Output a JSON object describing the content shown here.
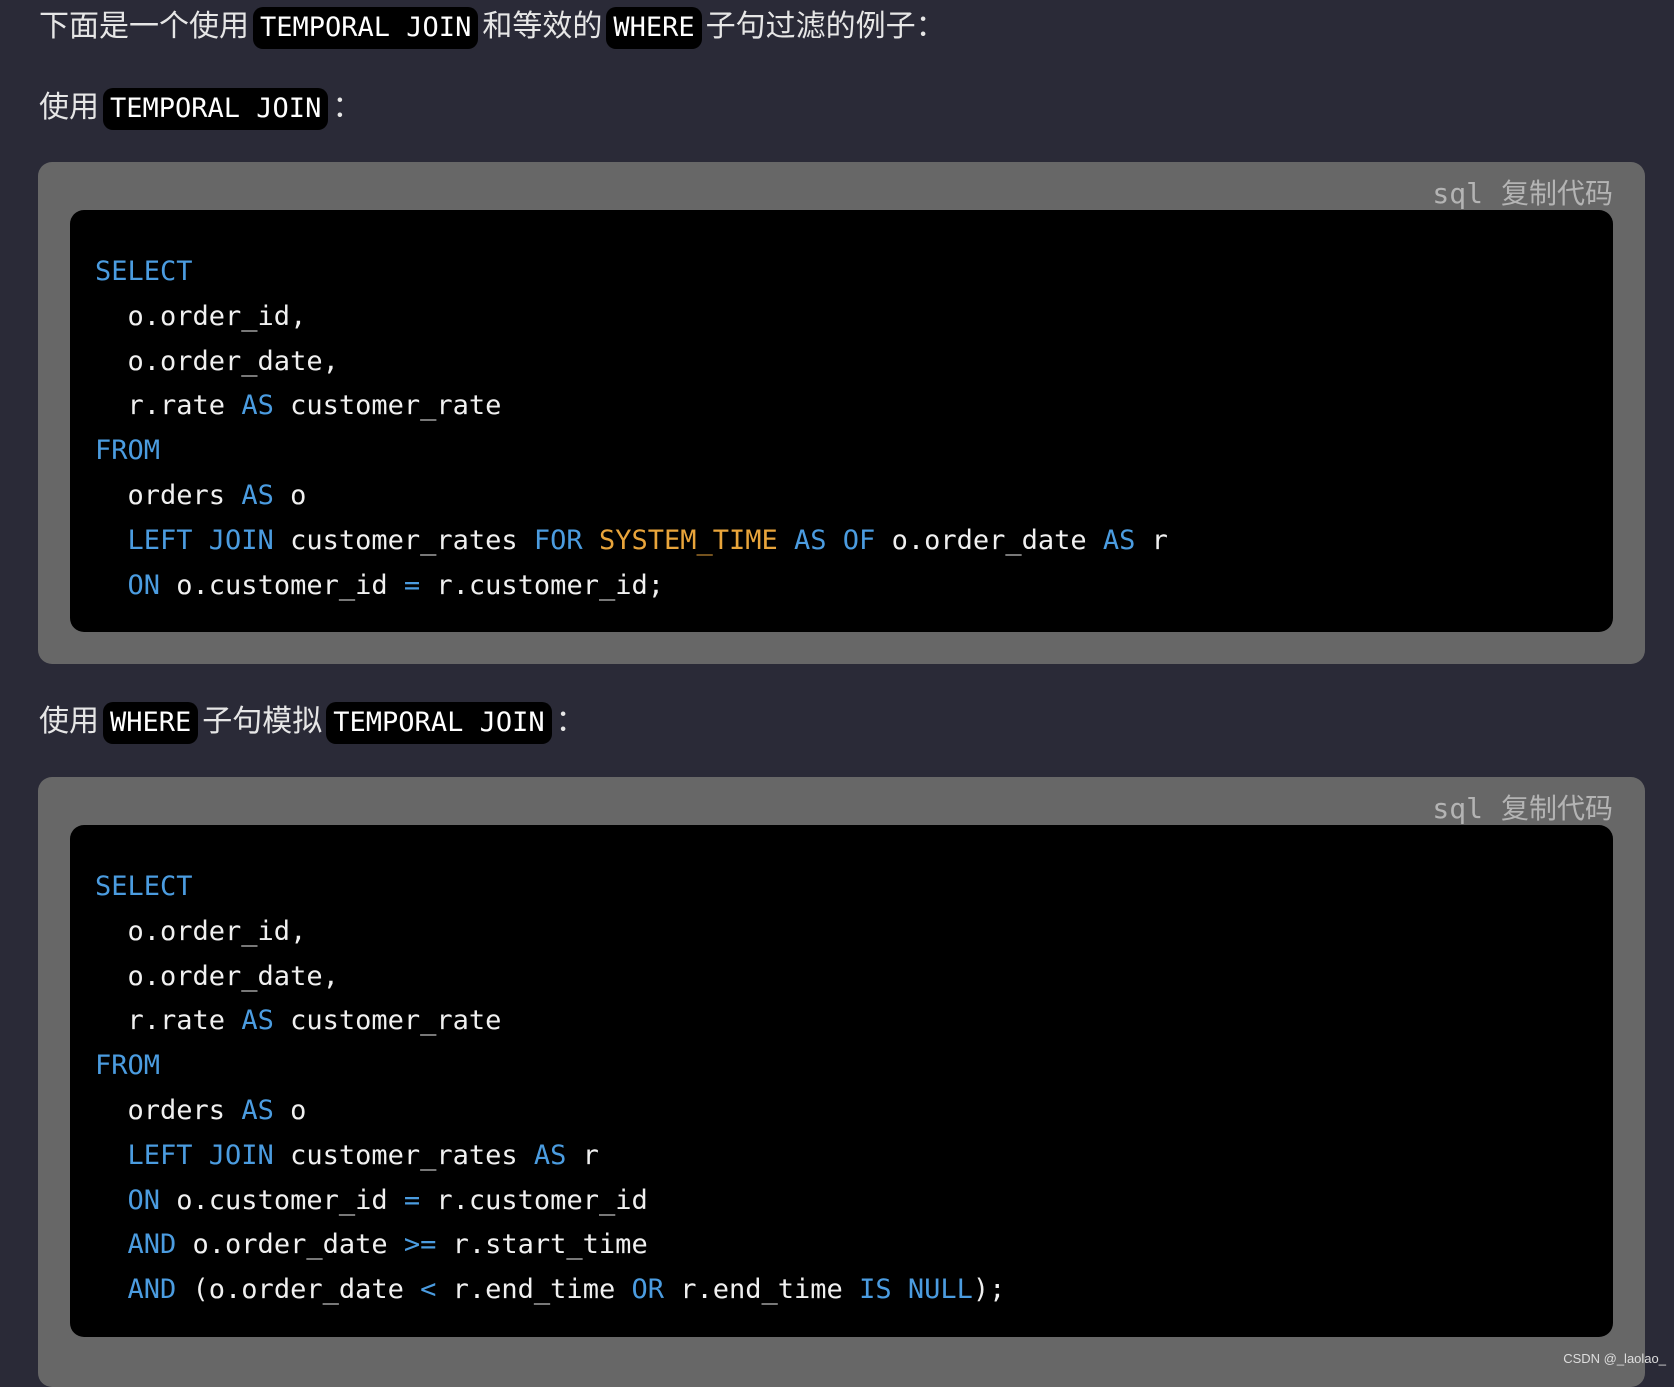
{
  "intro": {
    "t1": "下面是一个使用",
    "c1": "TEMPORAL JOIN",
    "t2": "和等效的",
    "c2": "WHERE",
    "t3": "子句过滤的例子："
  },
  "heading1": {
    "t1": "使用",
    "c1": "TEMPORAL JOIN",
    "t2": "："
  },
  "heading2": {
    "t1": "使用",
    "c1": "WHERE",
    "t2": "子句模拟",
    "c2": "TEMPORAL JOIN",
    "t3": "："
  },
  "block1": {
    "lang": "sql",
    "copy": "复制代码",
    "lines": [
      [
        [
          "k",
          "SELECT"
        ]
      ],
      [
        [
          "",
          "  o.order_id,"
        ]
      ],
      [
        [
          "",
          "  o.order_date,"
        ]
      ],
      [
        [
          "",
          "  r.rate "
        ],
        [
          "k",
          "AS"
        ],
        [
          "",
          " customer_rate"
        ]
      ],
      [
        [
          "k",
          "FROM"
        ]
      ],
      [
        [
          "",
          "  orders "
        ],
        [
          "k",
          "AS"
        ],
        [
          "",
          " o"
        ]
      ],
      [
        [
          "k",
          "  LEFT JOIN"
        ],
        [
          "",
          " customer_rates "
        ],
        [
          "k",
          "FOR"
        ],
        [
          "",
          " "
        ],
        [
          "o",
          "SYSTEM_TIME"
        ],
        [
          "",
          " "
        ],
        [
          "k",
          "AS OF"
        ],
        [
          "",
          " o.order_date "
        ],
        [
          "k",
          "AS"
        ],
        [
          "",
          " r"
        ]
      ],
      [
        [
          "k",
          "  ON"
        ],
        [
          "",
          " o.customer_id "
        ],
        [
          "k",
          "="
        ],
        [
          "",
          " r.customer_id;"
        ]
      ]
    ]
  },
  "block2": {
    "lang": "sql",
    "copy": "复制代码",
    "lines": [
      [
        [
          "k",
          "SELECT"
        ]
      ],
      [
        [
          "",
          "  o.order_id,"
        ]
      ],
      [
        [
          "",
          "  o.order_date,"
        ]
      ],
      [
        [
          "",
          "  r.rate "
        ],
        [
          "k",
          "AS"
        ],
        [
          "",
          " customer_rate"
        ]
      ],
      [
        [
          "k",
          "FROM"
        ]
      ],
      [
        [
          "",
          "  orders "
        ],
        [
          "k",
          "AS"
        ],
        [
          "",
          " o"
        ]
      ],
      [
        [
          "k",
          "  LEFT JOIN"
        ],
        [
          "",
          " customer_rates "
        ],
        [
          "k",
          "AS"
        ],
        [
          "",
          " r"
        ]
      ],
      [
        [
          "k",
          "  ON"
        ],
        [
          "",
          " o.customer_id "
        ],
        [
          "k",
          "="
        ],
        [
          "",
          " r.customer_id"
        ]
      ],
      [
        [
          "k",
          "  AND"
        ],
        [
          "",
          " o.order_date "
        ],
        [
          "k",
          ">="
        ],
        [
          "",
          " r.start_time"
        ]
      ],
      [
        [
          "k",
          "  AND"
        ],
        [
          "",
          " (o.order_date "
        ],
        [
          "k",
          "<"
        ],
        [
          "",
          " r.end_time "
        ],
        [
          "k",
          "OR"
        ],
        [
          "",
          " r.end_time "
        ],
        [
          "k",
          "IS NULL"
        ],
        [
          "",
          "););"
        ]
      ]
    ]
  },
  "watermark": "CSDN @_laolao_",
  "colors": {
    "background": "#2a2a37",
    "keyword": "#4b9ce0",
    "highlight": "#e9a53b",
    "block": "#676767"
  }
}
